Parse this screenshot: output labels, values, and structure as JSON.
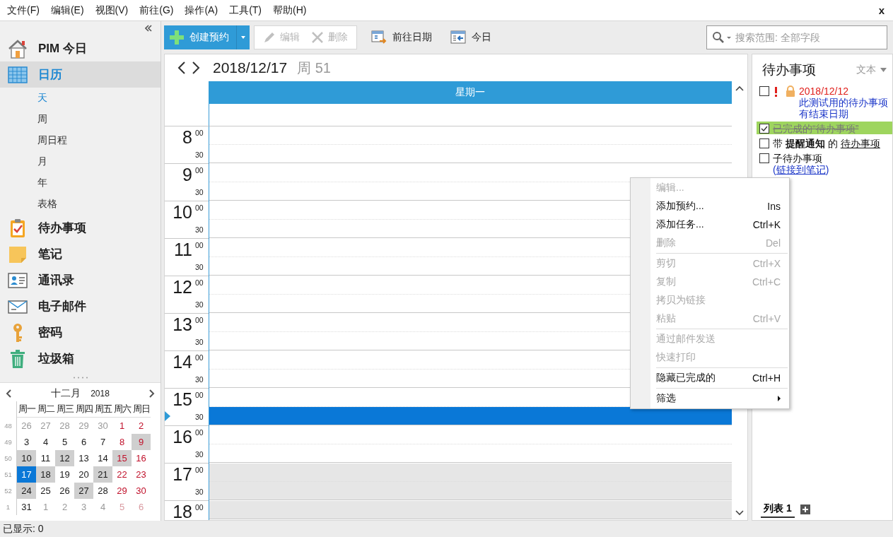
{
  "menu_bar": {
    "items": [
      "文件(F)",
      "编辑(E)",
      "视图(V)",
      "前往(G)",
      "操作(A)",
      "工具(T)",
      "帮助(H)"
    ],
    "close": "x"
  },
  "sidebar": {
    "items": [
      {
        "label": "PIM 今日",
        "selected": false
      },
      {
        "label": "日历",
        "selected": true,
        "children": [
          {
            "label": "天",
            "selected": true
          },
          {
            "label": "周",
            "selected": false
          },
          {
            "label": "周日程",
            "selected": false
          },
          {
            "label": "月",
            "selected": false
          },
          {
            "label": "年",
            "selected": false
          },
          {
            "label": "表格",
            "selected": false
          }
        ]
      },
      {
        "label": "待办事项",
        "selected": false
      },
      {
        "label": "笔记",
        "selected": false
      },
      {
        "label": "通讯录",
        "selected": false
      },
      {
        "label": "电子邮件",
        "selected": false
      },
      {
        "label": "密码",
        "selected": false
      },
      {
        "label": "垃圾箱",
        "selected": false
      }
    ]
  },
  "mini_calendar": {
    "month": "十二月",
    "year": "2018",
    "weekdays": [
      "周一",
      "周二",
      "周三",
      "周四",
      "周五",
      "周六",
      "周日"
    ],
    "weeks": [
      {
        "week": "48",
        "days": [
          {
            "d": "26",
            "other": true,
            "marked": false,
            "selected": false
          },
          {
            "d": "27",
            "other": true,
            "marked": false,
            "selected": false
          },
          {
            "d": "28",
            "other": true,
            "marked": false,
            "selected": false
          },
          {
            "d": "29",
            "other": true,
            "marked": false,
            "selected": false
          },
          {
            "d": "30",
            "other": true,
            "marked": false,
            "selected": false
          },
          {
            "d": "1",
            "other": false,
            "marked": false,
            "selected": false
          },
          {
            "d": "2",
            "other": false,
            "marked": false,
            "selected": false
          }
        ]
      },
      {
        "week": "49",
        "days": [
          {
            "d": "3",
            "other": false,
            "marked": false,
            "selected": false
          },
          {
            "d": "4",
            "other": false,
            "marked": false,
            "selected": false
          },
          {
            "d": "5",
            "other": false,
            "marked": false,
            "selected": false
          },
          {
            "d": "6",
            "other": false,
            "marked": false,
            "selected": false
          },
          {
            "d": "7",
            "other": false,
            "marked": false,
            "selected": false
          },
          {
            "d": "8",
            "other": false,
            "marked": false,
            "selected": false
          },
          {
            "d": "9",
            "other": false,
            "marked": true,
            "selected": false
          }
        ]
      },
      {
        "week": "50",
        "days": [
          {
            "d": "10",
            "other": false,
            "marked": true,
            "selected": false
          },
          {
            "d": "11",
            "other": false,
            "marked": false,
            "selected": false
          },
          {
            "d": "12",
            "other": false,
            "marked": true,
            "selected": false
          },
          {
            "d": "13",
            "other": false,
            "marked": false,
            "selected": false
          },
          {
            "d": "14",
            "other": false,
            "marked": false,
            "selected": false
          },
          {
            "d": "15",
            "other": false,
            "marked": true,
            "selected": false
          },
          {
            "d": "16",
            "other": false,
            "marked": false,
            "selected": false
          }
        ]
      },
      {
        "week": "51",
        "days": [
          {
            "d": "17",
            "other": false,
            "marked": false,
            "selected": true
          },
          {
            "d": "18",
            "other": false,
            "marked": true,
            "selected": false
          },
          {
            "d": "19",
            "other": false,
            "marked": false,
            "selected": false
          },
          {
            "d": "20",
            "other": false,
            "marked": false,
            "selected": false
          },
          {
            "d": "21",
            "other": false,
            "marked": true,
            "selected": false
          },
          {
            "d": "22",
            "other": false,
            "marked": false,
            "selected": false
          },
          {
            "d": "23",
            "other": false,
            "marked": false,
            "selected": false
          }
        ]
      },
      {
        "week": "52",
        "days": [
          {
            "d": "24",
            "other": false,
            "marked": true,
            "selected": false
          },
          {
            "d": "25",
            "other": false,
            "marked": false,
            "selected": false
          },
          {
            "d": "26",
            "other": false,
            "marked": false,
            "selected": false
          },
          {
            "d": "27",
            "other": false,
            "marked": true,
            "selected": false
          },
          {
            "d": "28",
            "other": false,
            "marked": false,
            "selected": false
          },
          {
            "d": "29",
            "other": false,
            "marked": false,
            "selected": false
          },
          {
            "d": "30",
            "other": false,
            "marked": false,
            "selected": false
          }
        ]
      },
      {
        "week": "1",
        "days": [
          {
            "d": "31",
            "other": false,
            "marked": false,
            "selected": false
          },
          {
            "d": "1",
            "other": true,
            "marked": false,
            "selected": false
          },
          {
            "d": "2",
            "other": true,
            "marked": false,
            "selected": false
          },
          {
            "d": "3",
            "other": true,
            "marked": false,
            "selected": false
          },
          {
            "d": "4",
            "other": true,
            "marked": false,
            "selected": false
          },
          {
            "d": "5",
            "other": true,
            "marked": false,
            "selected": false
          },
          {
            "d": "6",
            "other": true,
            "marked": false,
            "selected": false
          }
        ]
      }
    ]
  },
  "toolbar": {
    "buttons": [
      {
        "kind": "primary",
        "label": "创建预约",
        "disabled": false
      },
      {
        "kind": "plain",
        "label": "编辑",
        "disabled": true
      },
      {
        "kind": "plain",
        "label": "删除",
        "disabled": true
      },
      {
        "kind": "flat",
        "label": "前往日期",
        "disabled": false
      },
      {
        "kind": "flat",
        "label": "今日",
        "disabled": false
      }
    ],
    "search": {
      "placeholder": "搜索范围: 全部字段"
    }
  },
  "calendar": {
    "date": "2018/12/17",
    "week": "周 51",
    "day_header": "星期一",
    "hours": [
      {
        "hour": "8",
        "off": false,
        "slots": [
          {
            "label": "00",
            "selected": false,
            "now": false
          },
          {
            "label": "30",
            "selected": false,
            "now": false
          }
        ]
      },
      {
        "hour": "9",
        "off": false,
        "slots": [
          {
            "label": "00",
            "selected": false,
            "now": false
          },
          {
            "label": "30",
            "selected": false,
            "now": false
          }
        ]
      },
      {
        "hour": "10",
        "off": false,
        "slots": [
          {
            "label": "00",
            "selected": false,
            "now": false
          },
          {
            "label": "30",
            "selected": false,
            "now": false
          }
        ]
      },
      {
        "hour": "11",
        "off": false,
        "slots": [
          {
            "label": "00",
            "selected": false,
            "now": false
          },
          {
            "label": "30",
            "selected": false,
            "now": false
          }
        ]
      },
      {
        "hour": "12",
        "off": false,
        "slots": [
          {
            "label": "00",
            "selected": false,
            "now": false
          },
          {
            "label": "30",
            "selected": false,
            "now": false
          }
        ]
      },
      {
        "hour": "13",
        "off": false,
        "slots": [
          {
            "label": "00",
            "selected": false,
            "now": false
          },
          {
            "label": "30",
            "selected": false,
            "now": false
          }
        ]
      },
      {
        "hour": "14",
        "off": false,
        "slots": [
          {
            "label": "00",
            "selected": false,
            "now": false
          },
          {
            "label": "30",
            "selected": false,
            "now": false
          }
        ]
      },
      {
        "hour": "15",
        "off": false,
        "slots": [
          {
            "label": "00",
            "selected": false,
            "now": false
          },
          {
            "label": "30",
            "selected": true,
            "now": true
          }
        ]
      },
      {
        "hour": "16",
        "off": false,
        "slots": [
          {
            "label": "00",
            "selected": false,
            "now": false
          },
          {
            "label": "30",
            "selected": false,
            "now": false
          }
        ]
      },
      {
        "hour": "17",
        "off": true,
        "slots": [
          {
            "label": "00",
            "selected": false,
            "now": false
          },
          {
            "label": "30",
            "selected": false,
            "now": false
          }
        ]
      },
      {
        "hour": "18",
        "off": true,
        "slots": [
          {
            "label": "00",
            "selected": false,
            "now": false
          }
        ]
      }
    ]
  },
  "context_menu": {
    "items": [
      {
        "kind": "item",
        "label": "编辑...",
        "disabled": true,
        "submenu": false
      },
      {
        "kind": "item",
        "label": "添加预约...",
        "shortcut": "Ins",
        "disabled": false,
        "submenu": false
      },
      {
        "kind": "item",
        "label": "添加任务...",
        "shortcut": "Ctrl+K",
        "disabled": false,
        "submenu": false
      },
      {
        "kind": "item",
        "label": "删除",
        "shortcut": "Del",
        "disabled": true,
        "submenu": false
      },
      {
        "kind": "separator"
      },
      {
        "kind": "item",
        "label": "剪切",
        "shortcut": "Ctrl+X",
        "disabled": true,
        "submenu": false
      },
      {
        "kind": "item",
        "label": "复制",
        "shortcut": "Ctrl+C",
        "disabled": true,
        "submenu": false
      },
      {
        "kind": "item",
        "label": "拷贝为链接",
        "disabled": true,
        "submenu": false
      },
      {
        "kind": "item",
        "label": "粘贴",
        "shortcut": "Ctrl+V",
        "disabled": true,
        "submenu": false
      },
      {
        "kind": "separator"
      },
      {
        "kind": "item",
        "label": "通过邮件发送",
        "disabled": true,
        "submenu": false
      },
      {
        "kind": "item",
        "label": "快速打印",
        "disabled": true,
        "submenu": false
      },
      {
        "kind": "separator"
      },
      {
        "kind": "item",
        "label": "隐藏已完成的",
        "shortcut": "Ctrl+H",
        "disabled": false,
        "submenu": false
      },
      {
        "kind": "separator"
      },
      {
        "kind": "item",
        "label": "筛选",
        "disabled": false,
        "submenu": true
      }
    ]
  },
  "todo_panel": {
    "title": "待办事项",
    "view": "文本",
    "items": [
      {
        "checked": false,
        "highlighted": false,
        "priority": true,
        "locked": true,
        "due": "2018/12/12",
        "text": "此测试用的待办事项有结束日期"
      },
      {
        "checked": true,
        "highlighted": true,
        "priority": false,
        "locked": false,
        "text": "已完成的“待办事项”"
      },
      {
        "checked": false,
        "highlighted": false,
        "priority": false,
        "locked": false,
        "text": "带 **提醒通知** 的",
        "link": "待办事项"
      },
      {
        "checked": false,
        "highlighted": false,
        "priority": false,
        "locked": false,
        "text": "子待办事项",
        "note_link": {
          "prefix": "(",
          "link": "链接到笔记",
          "suffix": ")"
        }
      }
    ],
    "tabs": [
      {
        "label": "列表 1",
        "selected": true
      }
    ]
  },
  "status_bar": "已显示: 0"
}
